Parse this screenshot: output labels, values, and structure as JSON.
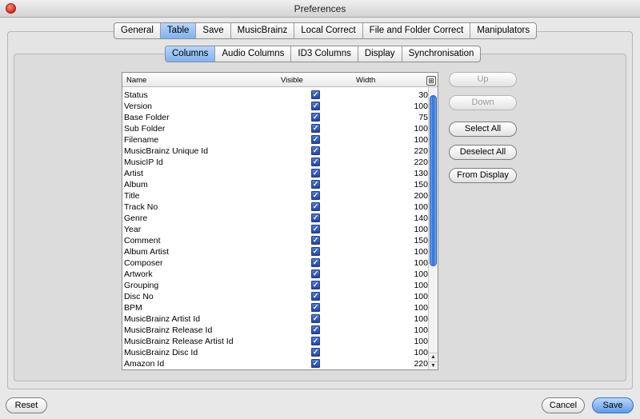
{
  "window": {
    "title": "Preferences"
  },
  "tabs": [
    "General",
    "Table",
    "Save",
    "MusicBrainz",
    "Local Correct",
    "File and Folder Correct",
    "Manipulators"
  ],
  "active_tab": "Table",
  "subtabs": [
    "Columns",
    "Audio Columns",
    "ID3 Columns",
    "Display",
    "Synchronisation"
  ],
  "active_subtab": "Columns",
  "table": {
    "headers": {
      "name": "Name",
      "visible": "Visible",
      "width": "Width"
    },
    "rows": [
      {
        "name": "Status",
        "visible": true,
        "width": "30"
      },
      {
        "name": "Version",
        "visible": true,
        "width": "100"
      },
      {
        "name": "Base Folder",
        "visible": true,
        "width": "75"
      },
      {
        "name": "Sub Folder",
        "visible": true,
        "width": "100"
      },
      {
        "name": "Filename",
        "visible": true,
        "width": "100"
      },
      {
        "name": "MusicBrainz Unique Id",
        "visible": true,
        "width": "220"
      },
      {
        "name": "MusicIP Id",
        "visible": true,
        "width": "220"
      },
      {
        "name": "Artist",
        "visible": true,
        "width": "130"
      },
      {
        "name": "Album",
        "visible": true,
        "width": "150"
      },
      {
        "name": "Title",
        "visible": true,
        "width": "200"
      },
      {
        "name": "Track No",
        "visible": true,
        "width": "100"
      },
      {
        "name": "Genre",
        "visible": true,
        "width": "140"
      },
      {
        "name": "Year",
        "visible": true,
        "width": "100"
      },
      {
        "name": "Comment",
        "visible": true,
        "width": "150"
      },
      {
        "name": "Album Artist",
        "visible": true,
        "width": "100"
      },
      {
        "name": "Composer",
        "visible": true,
        "width": "100"
      },
      {
        "name": "Artwork",
        "visible": true,
        "width": "100"
      },
      {
        "name": "Grouping",
        "visible": true,
        "width": "100"
      },
      {
        "name": "Disc No",
        "visible": true,
        "width": "100"
      },
      {
        "name": "BPM",
        "visible": true,
        "width": "100"
      },
      {
        "name": "MusicBrainz Artist Id",
        "visible": true,
        "width": "100"
      },
      {
        "name": "MusicBrainz Release Id",
        "visible": true,
        "width": "100"
      },
      {
        "name": "MusicBrainz Release Artist Id",
        "visible": true,
        "width": "100"
      },
      {
        "name": "MusicBrainz Disc Id",
        "visible": true,
        "width": "100"
      },
      {
        "name": "Amazon Id",
        "visible": true,
        "width": "220"
      }
    ]
  },
  "side_buttons": {
    "up": "Up",
    "down": "Down",
    "select_all": "Select All",
    "deselect_all": "Deselect All",
    "from_display": "From Display"
  },
  "bottom_buttons": {
    "reset": "Reset",
    "cancel": "Cancel",
    "save": "Save"
  },
  "icons": {
    "close": "close-icon",
    "column_picker": "column-picker-icon",
    "checkbox": "check-icon",
    "scroll_up": "arrow-up-icon",
    "scroll_down": "arrow-down-icon"
  },
  "colors": {
    "accent": "#7fb2ee",
    "scroll_thumb": "#2f6fd8",
    "close": "#d32a1a"
  }
}
